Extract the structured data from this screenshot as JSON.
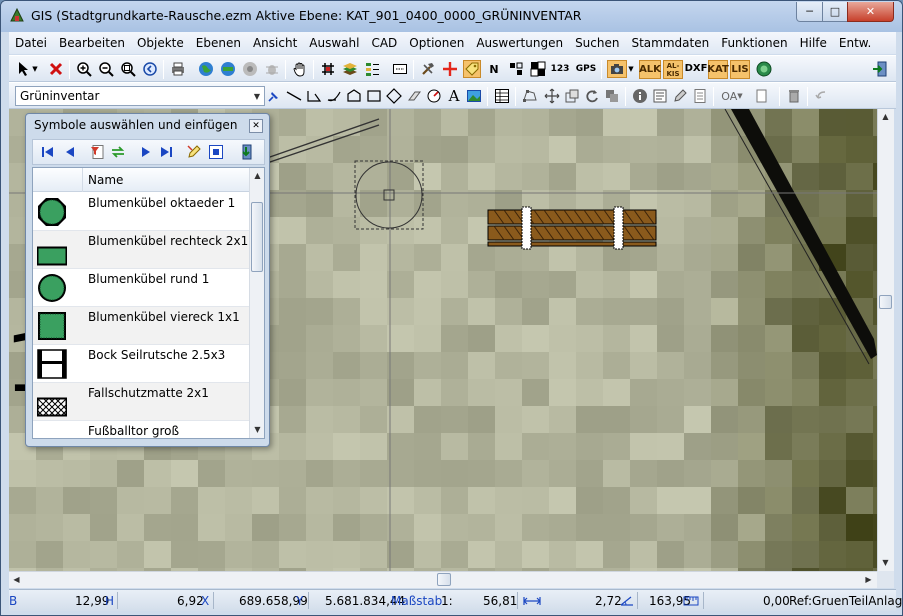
{
  "window": {
    "title": "GIS (Stadtgrundkarte-Rausche.ezm Aktive Ebene: KAT_901_0400_0000_GRÜNINVENTAR",
    "minimize": "─",
    "maximize": "□",
    "close": "✕"
  },
  "menu": [
    "Datei",
    "Bearbeiten",
    "Objekte",
    "Ebenen",
    "Ansicht",
    "Auswahl",
    "CAD",
    "Optionen",
    "Auswertungen",
    "Suchen",
    "Stammdaten",
    "Funktionen",
    "Hilfe",
    "Entw."
  ],
  "toolbar1": {
    "gps_label": "GPS",
    "alk_label": "ALK",
    "alkis_label": "AL-KIS",
    "dxf_label": "DXF",
    "kat_label": "KAT",
    "lis_label": "LIS",
    "n_label": "N",
    "count_label": "123"
  },
  "toolbar2": {
    "layer_value": "Grüninventar",
    "text_tool": "A",
    "oa_label": "OA"
  },
  "panel": {
    "title": "Symbole auswählen und einfügen",
    "close": "✕",
    "column_name": "Name",
    "items": [
      {
        "name": "Blumenkübel oktaeder 1",
        "icon": "octagon-planter-icon"
      },
      {
        "name": "Blumenkübel rechteck 2x1",
        "icon": "rectangle-planter-icon"
      },
      {
        "name": "Blumenkübel rund 1",
        "icon": "round-planter-icon"
      },
      {
        "name": "Blumenkübel viereck 1x1",
        "icon": "square-planter-icon"
      },
      {
        "name": "Bock Seilrutsche 2.5x3",
        "icon": "zipline-frame-icon"
      },
      {
        "name": "Fallschutzmatte 2x1",
        "icon": "safety-mat-icon"
      },
      {
        "name": "Fußballtor groß",
        "icon": "football-goal-icon"
      }
    ]
  },
  "status": {
    "b_label": "B",
    "h_value": "12,99",
    "h_unit": "H",
    "x_value": "6,92",
    "x_unit": "X",
    "y_value": "689.658,99",
    "y_unit": "Y",
    "r_value": "5.681.834,44",
    "scale_label": "Maßstab",
    "scale_value": "1:",
    "scale_num": "56,81",
    "dist_value": "2,72",
    "angle_value": "163,95",
    "ref_value": "0,00",
    "ref_text": "Ref:GruenTeilAnlage"
  },
  "colors": {
    "accent_blue": "#1b47c2",
    "close_red": "#c7402b",
    "bench_brown": "#8a5a1c"
  }
}
